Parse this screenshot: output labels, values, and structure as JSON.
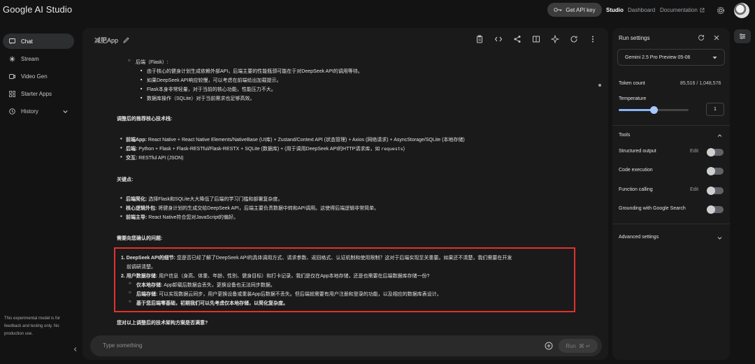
{
  "app": {
    "title": "Google AI Studio"
  },
  "header": {
    "get_api_key": "Get API key",
    "nav": {
      "studio": "Studio",
      "dashboard": "Dashboard",
      "documentation": "Documentation"
    }
  },
  "sidebar": {
    "items": [
      {
        "label": "Chat",
        "icon": "chat-icon",
        "active": true
      },
      {
        "label": "Stream",
        "icon": "stream-icon"
      },
      {
        "label": "Video Gen",
        "icon": "video-icon"
      },
      {
        "label": "Starter Apps",
        "icon": "apps-icon"
      },
      {
        "label": "History",
        "icon": "history-icon"
      }
    ],
    "disclaimer": "This experimental model is for feedback and testing only. No production use."
  },
  "chat": {
    "title": "减肥App",
    "lines": {
      "backend_flask": "后端（Flask）:",
      "b1": "由于核心的健身计划生成依赖外部API，后端主要的性能瓶颈可能在于对DeepSeek API的调用等待。",
      "b2": "如果DeepSeek API响应较慢，可以考虑在前端给出加载提示。",
      "b3": "Flask本身非常轻量，对于当前的核心功能，性能压力不大。",
      "b4": "数据库操作（SQLite）对于当前需求也足够高效。",
      "stack_heading": "调整后的推荐核心技术栈:",
      "frontend_label": "前端App:",
      "frontend_text": "React Native + React Native Elements/NativeBase (UI库) + Zustand/Context API (状态管理) + Axios (网络请求) + AsyncStorage/SQLite (本地存储)",
      "backend_label": "后端:",
      "backend_text_a": "Python + Flask + Flask-RESTful/Flask-RESTX + SQLite (数据库) + (用于调用DeepSeek API的HTTP请求库，如 ",
      "backend_text_code": "requests",
      "backend_text_b": ")",
      "interact_label": "交互:",
      "interact_text": "RESTful API (JSON)",
      "key_heading": "关键点:",
      "k1_label": "后端简化:",
      "k1_text": "选择Flask和SQLite大大降低了后端的学习门槛和部署复杂度。",
      "k2_label": "核心逻辑外包:",
      "k2_text": "将健身计划的生成交给DeepSeek API，后端主要负责数据中转和API调用。这使得后端逻辑非常简单。",
      "k3_label": "前端主导:",
      "k3_text": "React Native符合您对JavaScript的偏好。",
      "confirm_heading": "需要向您确认的问题:",
      "q1_label": "1. DeepSeek API的细节:",
      "q1_text": "您是否已经了解了DeepSeek API的具体调用方式、请求参数、返回格式、认证机制和使用限制？这对于后端实现至关重要。如果还不清楚，我们需要在开发",
      "q1_text2": "前调研清楚。",
      "q2_label": "2. 用户数据存储:",
      "q2_text": "用户信息（身高、体重、年龄、性别、健身目标）和打卡记录，我们是仅在App本地存储，还是也需要在后端数据库存储一份?",
      "q2a_label": "仅本地存储:",
      "q2a_text": "App卸载后数据会丢失，更换设备也无法同步数据。",
      "q2b_label": "后端存储:",
      "q2b_text": "可以实现数据云同步，用户更换设备或重装App后数据不丢失。但后端就需要有用户注册和登录的功能，以及相应的数据库表设计。",
      "q2c": "基于您后端零基础，初期我们可以先考虑仅本地存储，以简化复杂度。",
      "final_q": "您对以上调整后的技术架构方案是否满意?"
    },
    "input_placeholder": "Type something",
    "run_label": "Run",
    "run_shortcut": "⌘ ↵"
  },
  "run_settings": {
    "title": "Run settings",
    "model": "Gemini 2.5 Pro Preview 05-06",
    "token_count_label": "Token count",
    "token_count_value": "85,516 / 1,048,576",
    "temperature_label": "Temperature",
    "temperature_value": "1",
    "temperature_fraction": 0.5,
    "tools_label": "Tools",
    "tools": [
      {
        "label": "Structured output",
        "edit": "Edit",
        "enabled": false
      },
      {
        "label": "Code execution",
        "enabled": false
      },
      {
        "label": "Function calling",
        "edit": "Edit",
        "enabled": false
      },
      {
        "label": "Grounding with Google Search",
        "enabled": false
      }
    ],
    "advanced_label": "Advanced settings"
  },
  "colors": {
    "highlight_border": "#e0322f",
    "accent": "#8ab4f8"
  }
}
